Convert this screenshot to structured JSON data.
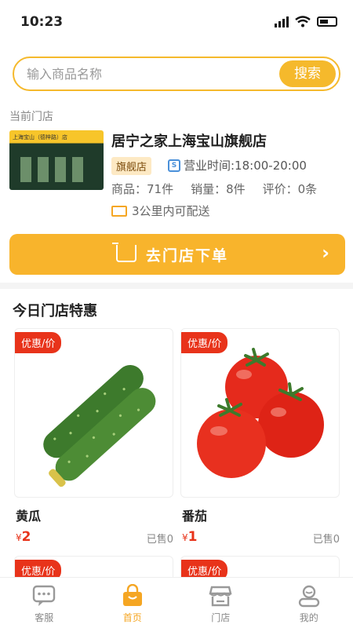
{
  "status": {
    "time": "10:23"
  },
  "search": {
    "placeholder": "输入商品名称",
    "button": "搜索"
  },
  "store": {
    "section_label": "当前门店",
    "name": "居宁之家上海宝山旗舰店",
    "tag": "旗舰店",
    "hours": "营业时间:18:00-20:00",
    "products": "商品：71件",
    "sales": "销量：8件",
    "reviews": "评价：0条",
    "delivery": "3公里内可配送",
    "image_sign": "上海宝山（德梓路）店"
  },
  "order_button": {
    "label": "去门店下单",
    "arrow": "›"
  },
  "deals": {
    "title": "今日门店特惠",
    "badge": "优惠/价",
    "items": [
      {
        "name": "黄瓜",
        "currency": "¥",
        "price": "2",
        "sold": "已售0",
        "icon": "cucumber-image"
      },
      {
        "name": "番茄",
        "currency": "¥",
        "price": "1",
        "sold": "已售0",
        "icon": "tomato-image"
      }
    ]
  },
  "tabbar": {
    "items": [
      {
        "label": "客服",
        "icon": "chat-icon"
      },
      {
        "label": "首页",
        "icon": "home-bag-icon"
      },
      {
        "label": "门店",
        "icon": "store-icon"
      },
      {
        "label": "我的",
        "icon": "user-icon"
      }
    ]
  },
  "colors": {
    "accent": "#f5b92c",
    "price": "#e8331a",
    "badge": "#e8331a"
  }
}
